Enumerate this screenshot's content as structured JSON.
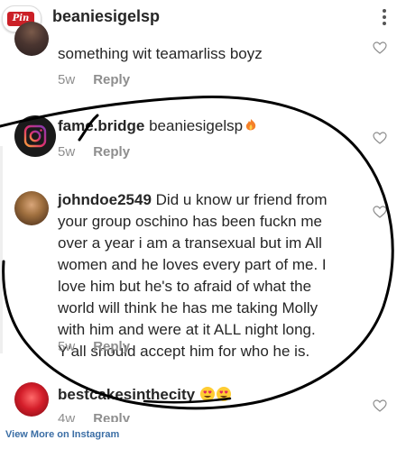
{
  "header": {
    "pin_label": "Pin it",
    "username": "beaniesigelsp"
  },
  "comments": [
    {
      "text": "something wit teamarliss boyz",
      "time": "5w",
      "reply": "Reply"
    },
    {
      "username": "fame.bridge",
      "mention": "beaniesigelsp",
      "time": "5w",
      "reply": "Reply"
    },
    {
      "username": "johndoe2549",
      "lines": [
        " Did u know ur friend from",
        "your group oschino has been fuckn me",
        "over a year i am a transexual but im All",
        "women and he loves every part of me.  I",
        "love him but he's to afraid of what the",
        "world will think he has me taking Molly",
        "with him and were at it ALL night long.",
        "Y'all should accept him for who he is."
      ],
      "time": "5w",
      "reply": "Reply"
    },
    {
      "username": "bestcakesinthecity",
      "time": "4w",
      "reply": "Reply"
    }
  ],
  "footer": {
    "link_text": "View More on Instagram"
  },
  "colors": {
    "text": "#262626",
    "muted": "#8e8e8e",
    "link": "#3b6ea5",
    "pinterest": "#cb2027",
    "annotation": "#000000"
  },
  "icons": [
    "more-vertical-icon",
    "heart-icon",
    "smiling-heart-eyes-emoji",
    "fire-emoji"
  ]
}
